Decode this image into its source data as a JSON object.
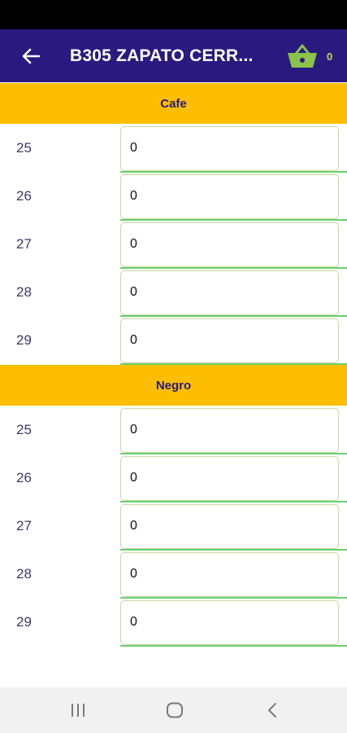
{
  "app_bar": {
    "back_icon": "arrow-left-icon",
    "title": "B305 ZAPATO CERR...",
    "cart_icon": "basket-icon",
    "cart_count": "0"
  },
  "colors": {
    "app_bar": "#2a1a80",
    "section_header": "#fdbe02",
    "input_underline": "#6dd070",
    "cart_icon": "#8bc34a"
  },
  "sections": [
    {
      "name": "Cafe",
      "rows": [
        {
          "size": "25",
          "qty": "0"
        },
        {
          "size": "26",
          "qty": "0"
        },
        {
          "size": "27",
          "qty": "0"
        },
        {
          "size": "28",
          "qty": "0"
        },
        {
          "size": "29",
          "qty": "0"
        }
      ]
    },
    {
      "name": "Negro",
      "rows": [
        {
          "size": "25",
          "qty": "0"
        },
        {
          "size": "26",
          "qty": "0"
        },
        {
          "size": "27",
          "qty": "0"
        },
        {
          "size": "28",
          "qty": "0"
        },
        {
          "size": "29",
          "qty": "0"
        }
      ]
    }
  ],
  "nav_bar": {
    "recents_icon": "recents-icon",
    "home_icon": "home-icon",
    "back_icon": "back-chevron-icon"
  }
}
